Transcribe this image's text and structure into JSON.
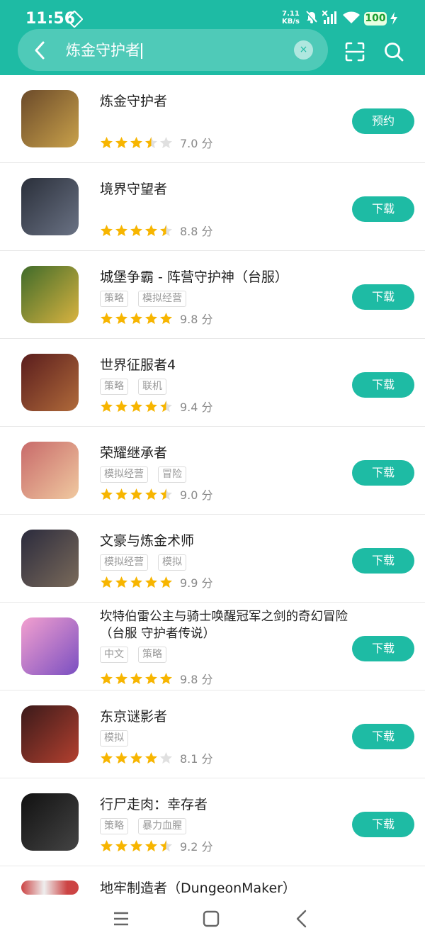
{
  "status_bar": {
    "time": "11:56",
    "speed_value": "7.11",
    "speed_unit": "KB/s",
    "battery": "100"
  },
  "search": {
    "query": "炼金守护者",
    "clear_symbol": "×"
  },
  "apps": [
    {
      "name": "炼金守护者",
      "tags": [],
      "stars": 3.5,
      "score": "7.0 分",
      "action": "预约",
      "icon_colors": [
        "#6b4a2a",
        "#c9a14a"
      ]
    },
    {
      "name": "境界守望者",
      "tags": [],
      "stars": 4.5,
      "score": "8.8 分",
      "action": "下载",
      "icon_colors": [
        "#2a2f3a",
        "#6a7284"
      ]
    },
    {
      "name": "城堡争霸 - 阵营守护神（台服）",
      "tags": [
        "策略",
        "模拟经营"
      ],
      "stars": 5,
      "score": "9.8 分",
      "action": "下载",
      "icon_colors": [
        "#3f6b2a",
        "#d9b340"
      ]
    },
    {
      "name": "世界征服者4",
      "tags": [
        "策略",
        "联机"
      ],
      "stars": 4.5,
      "score": "9.4 分",
      "action": "下载",
      "icon_colors": [
        "#5a1d1d",
        "#b06a3a"
      ]
    },
    {
      "name": "荣耀继承者",
      "tags": [
        "模拟经营",
        "冒险"
      ],
      "stars": 4.5,
      "score": "9.0 分",
      "action": "下载",
      "icon_colors": [
        "#c86a6a",
        "#f0c9a0"
      ]
    },
    {
      "name": "文豪与炼金术师",
      "tags": [
        "模拟经营",
        "模拟"
      ],
      "stars": 5,
      "score": "9.9 分",
      "action": "下载",
      "icon_colors": [
        "#2b2b3d",
        "#7a6a5a"
      ]
    },
    {
      "name": "坎特伯雷公主与骑士唤醒冠军之剑的奇幻冒险（台服 守护者传说）",
      "tags": [
        "中文",
        "策略"
      ],
      "stars": 5,
      "score": "9.8 分",
      "action": "下载",
      "icon_colors": [
        "#f3a0cf",
        "#7a4fc1"
      ]
    },
    {
      "name": "东京谜影者",
      "tags": [
        "模拟"
      ],
      "stars": 4,
      "score": "8.1 分",
      "action": "下载",
      "icon_colors": [
        "#3a1a1a",
        "#b3402f"
      ]
    },
    {
      "name": "行尸走肉：幸存者",
      "tags": [
        "策略",
        "暴力血腥"
      ],
      "stars": 4.5,
      "score": "9.2 分",
      "action": "下载",
      "icon_colors": [
        "#111111",
        "#444444"
      ]
    }
  ],
  "partial_app": {
    "name": "地牢制造者（DungeonMaker）"
  },
  "colors": {
    "accent": "#1ebba4",
    "star": "#f7b500",
    "star_empty": "#e0e0e0"
  }
}
